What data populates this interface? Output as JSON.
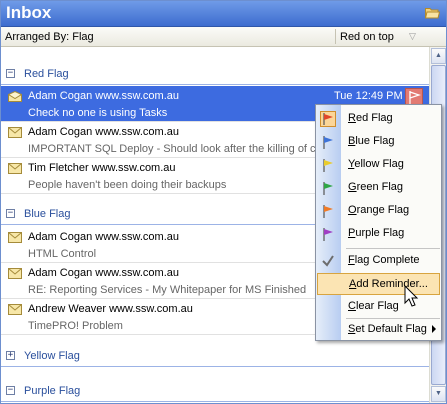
{
  "header": {
    "title": "Inbox",
    "folder_icon": "folder-open-icon"
  },
  "arrange_bar": {
    "label": "Arranged By: Flag",
    "order": "Red on top"
  },
  "groups": [
    {
      "label": "Red Flag",
      "expanded": true
    },
    {
      "label": "Blue Flag",
      "expanded": true
    },
    {
      "label": "Yellow Flag",
      "expanded": false
    },
    {
      "label": "Purple Flag",
      "expanded": true
    }
  ],
  "messages": [
    {
      "sender": "Adam Cogan www.ssw.com.au",
      "subject": "Check no one is using Tasks",
      "time": "Tue 12:49 PM",
      "selected": true
    },
    {
      "sender": "Adam Cogan www.ssw.com.au",
      "subject": "IMPORTANT SQL Deploy - Should look after the killing of con",
      "time": ""
    },
    {
      "sender": "Tim Fletcher www.ssw.com.au",
      "subject": "People haven't been doing their backups",
      "time": ""
    },
    {
      "sender": "Adam Cogan www.ssw.com.au",
      "subject": "HTML Control",
      "time": ""
    },
    {
      "sender": "Adam Cogan www.ssw.com.au",
      "subject": "RE: Reporting Services - My Whitepaper for MS Finished",
      "time": ""
    },
    {
      "sender": "Andrew Weaver www.ssw.com.au",
      "subject": "TimePRO! Problem",
      "time": ""
    }
  ],
  "context_menu": {
    "items": [
      {
        "label": "Red Flag",
        "icon": "red-flag-icon",
        "color": "#e0462b",
        "checked": true
      },
      {
        "label": "Blue Flag",
        "icon": "blue-flag-icon",
        "color": "#3e73d8"
      },
      {
        "label": "Yellow Flag",
        "icon": "yellow-flag-icon",
        "color": "#e9cc2d"
      },
      {
        "label": "Green Flag",
        "icon": "green-flag-icon",
        "color": "#2fa646"
      },
      {
        "label": "Orange Flag",
        "icon": "orange-flag-icon",
        "color": "#ef7a26"
      },
      {
        "label": "Purple Flag",
        "icon": "purple-flag-icon",
        "color": "#a03ec4"
      },
      {
        "label": "Flag Complete",
        "icon": "checkmark-icon"
      },
      {
        "label": "Add Reminder...",
        "highlighted": true
      },
      {
        "label": "Clear Flag"
      },
      {
        "label": "Set Default Flag",
        "submenu": true
      }
    ]
  },
  "colors": {
    "accent": "#3d6be0",
    "title_bar": "#4a78d8",
    "group_text": "#2a4f9c",
    "highlight": "#fbe4b3"
  }
}
